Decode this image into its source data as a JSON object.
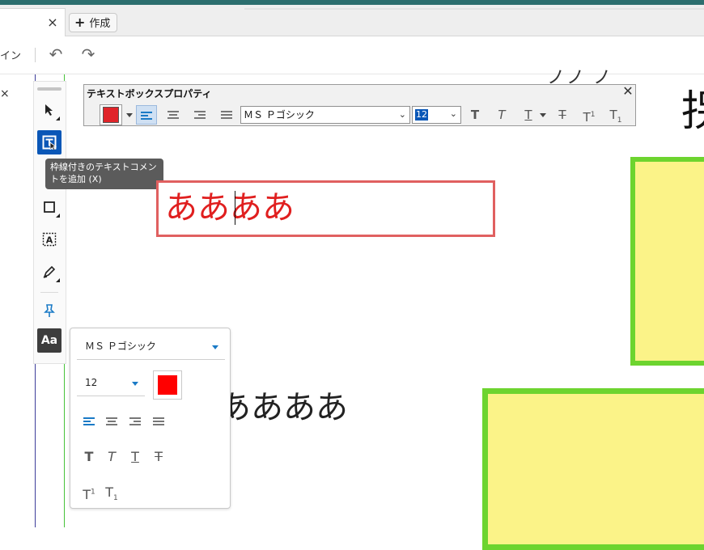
{
  "tabs": {
    "close_glyph": "×",
    "new_tab_label": "作成",
    "new_tab_plus": "+"
  },
  "toolbar": {
    "cropped_label": "イン",
    "undo_glyph": "↶",
    "redo_glyph": "↷"
  },
  "left_panel": {
    "close_glyph": "×"
  },
  "tools": {
    "aa_label": "Aa"
  },
  "tooltip": {
    "line1": "枠線付きのテキストコメン",
    "line2": "トを追加 (X)"
  },
  "properties_toolbar": {
    "title": "テキストボックスプロパティ",
    "close_glyph": "✕",
    "font_family": "ＭＳ Ｐゴシック",
    "font_size": "12",
    "color": "#e0242a"
  },
  "canvas": {
    "top_partial_text": "ノノ ノ",
    "big_kanji": "拐",
    "editing_text_before_caret": "ああ",
    "editing_text_after_caret": "ああ",
    "lower_text": "ああああ",
    "text_color": "#e01f1f",
    "box_fill": "#fbf388",
    "box_border": "#6dd42f"
  },
  "font_panel": {
    "font_family": "ＭＳ Ｐゴシック",
    "font_size": "12",
    "color": "#ff0000"
  }
}
